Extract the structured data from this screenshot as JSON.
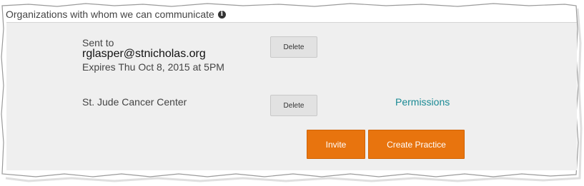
{
  "section": {
    "title": "Organizations with whom we can communicate",
    "info_icon": "info-icon"
  },
  "pending_invite": {
    "sent_label": "Sent to",
    "email": "rglasper@stnicholas.org",
    "expires": "Expires Thu Oct 8, 2015 at 5PM",
    "delete_label": "Delete"
  },
  "organization": {
    "name": "St. Jude Cancer Center",
    "delete_label": "Delete",
    "permissions_label": "Permissions"
  },
  "actions": {
    "invite_label": "Invite",
    "create_practice_label": "Create Practice"
  },
  "colors": {
    "accent_orange": "#e8740e",
    "link_teal": "#1a8a94",
    "panel_bg": "#efefef"
  }
}
